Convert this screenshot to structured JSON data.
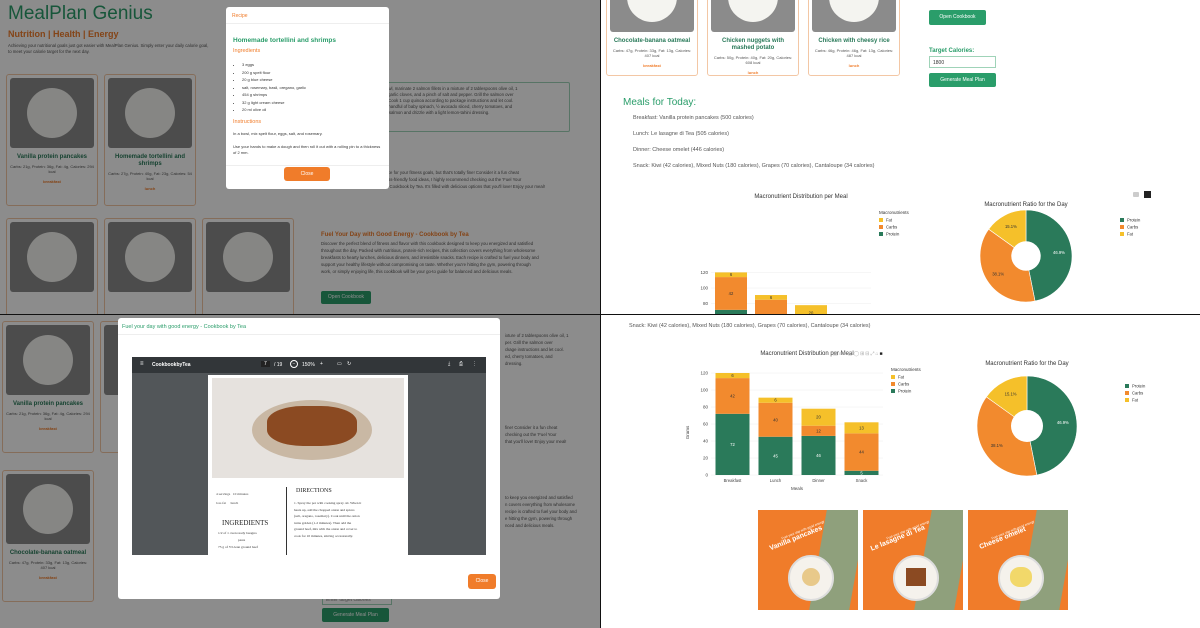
{
  "app": {
    "title": "MealPlan Genius",
    "tagline": "Nutrition | Health | Energy",
    "intro": "Achieving your nutritional goals just got easier with MealPlan Genius. Simply enter your daily calorie goal,",
    "intro2": "to meet your calorie target for the next day."
  },
  "meals": [
    {
      "name": "Vanilla protein pancakes",
      "macros": "Carbs: 21g, Protein: 36g, Fat: 4g, Calories: 294 kcal",
      "label": "breakfast"
    },
    {
      "name": "Homemade tortellini and shrimps",
      "macros": "Carbs: 27g, Protein: 40g, Fat: 23g, Calories: 54 kcal",
      "label": "lunch"
    },
    {
      "name": "Chocolate-banana oatmeal",
      "macros": "Carbs: 47g, Protein: 33g, Fat: 13g, Calories: 407 kcal",
      "label": "breakfast"
    },
    {
      "name": "Chicken nuggets with mashed potato",
      "macros": "Carbs: 50g, Protein: 40g, Fat: 20g, Calories: 608 kcal",
      "label": "lunch"
    },
    {
      "name": "Chicken with cheesy rice",
      "macros": "Carbs: 46g, Protein: 46g, Fat: 13g, Calories: 487 kcal",
      "label": "lunch"
    }
  ],
  "recipe_modal": {
    "header": "Recipe",
    "title": "Homemade tortellini and shrimps",
    "ingredients_title": "Ingredients",
    "ingredients": [
      "3 eggs",
      "200 g spelt flour",
      "20 g blue cheese",
      "salt, rosemary, basil, oregano, garlic",
      "454 g shrimps",
      "32 g light cream cheese",
      "20 ml olive oil"
    ],
    "instructions_title": "Instructions",
    "instructions": [
      "In a bowl, mix spelt flour, eggs, salt, and rosemary.",
      "Use your hands to make a dough and then roll it out with a rolling pin to a thickness of 2 mm."
    ],
    "close": "Close"
  },
  "q1_side": {
    "line1": "e bowl, marinate 2 salmon fillets in a mixture of 2 tablespoons olive oil, 1",
    "line2": "ced garlic cloves, and a pinch of salt and pepper. Grill the salmon over",
    "line3": "ide. Cook 1 cup quinoa according to package instructions and let cool.",
    "line4": "e, a handful of baby spinach, ½ avocado sliced, cherry tomatoes, and",
    "line5": "illed salmon and drizzle with a light lemon-tahini dressing.",
    "choice1": "choice for your fitness goals, but that's totally fine! Consider it a fun cheat",
    "choice2": "fitness-friendly food ideas, I highly recommend checking out the 'Fuel Your",
    "choice3": "ergy Cookbook by Tea. It's filled with delicious options that you'll love! Enjoy your meal!"
  },
  "cookbook": {
    "title": "Fuel Your Day with Good Energy - Cookbook by Tea",
    "desc": [
      "Discover the perfect blend of fitness and flavor with this cookbook designed to keep you energized and satisfied",
      "throughout the day. Packed with nutritious, protein-rich recipes, this collection covers everything from wholesome",
      "breakfasts to hearty lunches, delicious dinners, and irresistible snacks. Each recipe is crafted to fuel your body and",
      "support your healthy lifestyle without compromising on taste. Whether you're hitting the gym, powering through",
      "work, or simply enjoying life, this cookbook will be your go-to guide for balanced and delicious meals."
    ],
    "button": "Open Cookbook"
  },
  "target": {
    "label": "Target Calories:",
    "value": "1800",
    "placeholder": "Enter target calories",
    "button": "Generate Meal Plan"
  },
  "today": {
    "heading": "Meals for Today:",
    "breakfast": "Breakfast: Vanilla protein pancakes (500 calories)",
    "lunch": "Lunch: Le lasagne di Tea (505 calories)",
    "dinner": "Dinner: Cheese omelet (446 calories)",
    "snack": "Snack: Kiwi (42 calories), Mixed Nuts (180 calories), Grapes (70 calories), Cantaloupe (34 calories)"
  },
  "pdf_modal": {
    "header": "Fuel your day with good energy - Cookbook by Tea",
    "doc_name": "CookbookbyTea",
    "page": "7",
    "of": "/ 19",
    "zoom": "150%",
    "directions": "DIRECTIONS",
    "ingredients": "INGREDIENTS",
    "ing1": "1/2 of 1 oven ready lasagna",
    "ing2": "pasta",
    "ing3": "75 g of 5% lean ground beef",
    "meta1": "4 servings",
    "meta2": "10 minutes",
    "meta3": "low-fat",
    "meta4": "lunch",
    "step1": "1. Spray the pot with cooking spray oil. When it",
    "step2": "heats up, add the chopped onion and spices",
    "step3": "(salt, oregano, rosemary). Cook until the onion",
    "step4": "turns golden (1-2 minutes). Then add the",
    "step5": "ground beef, mix with the onion and cover to",
    "step6": "cook for 10 minutes, stirring occasionally.",
    "close": "Close"
  },
  "q3_side": {
    "a": "ixture of 2 tablespoons olive oil, 1",
    "b": "per. Grill the salmon over",
    "c": "ckage instructions and let cool.",
    "d": "ed, cherry tomatoes, and",
    "e": "dressing.",
    "f": "fine! Consider it a fun cheat",
    "g": "checking out the 'Fuel Your",
    "h": "that you'll love! Enjoy your meal!",
    "i": "to keep you energized and satisfied",
    "j": "n covers everything from wholesome",
    "k": "recipe is crafted to fuel your body and",
    "l": "e hitting the gym, powering through",
    "m": "nced and delicious meals."
  },
  "posters": [
    {
      "title": "Vanilla pancakes"
    },
    {
      "title": "Le lasagne di Tea"
    },
    {
      "title": "Cheese omelet"
    }
  ],
  "poster_tag": "Fuel your day with good energy",
  "colors": {
    "green": "#2a9d6a",
    "orange": "#f07c2a",
    "protein": "#2a7a5a",
    "carbs": "#f28a2e",
    "fat": "#f5c02a"
  },
  "chart_data": [
    {
      "type": "bar",
      "title": "Macronutrient Distribution per Meal",
      "xlabel": "Meals",
      "ylabel": "Grams",
      "ylim": [
        0,
        130
      ],
      "categories": [
        "Breakfast",
        "Lunch",
        "Dinner",
        "Snack"
      ],
      "legend_title": "Macronutrients",
      "series": [
        {
          "name": "Protein",
          "values": [
            72,
            45,
            46,
            5
          ]
        },
        {
          "name": "Carbs",
          "values": [
            42,
            40,
            12,
            44
          ]
        },
        {
          "name": "Fat",
          "values": [
            6,
            6,
            20,
            13
          ]
        }
      ],
      "stacked": true,
      "legend": "top-right"
    },
    {
      "type": "pie",
      "title": "Macronutrient Ratio for the Day",
      "hole": true,
      "labels": [
        "Protein",
        "Carbs",
        "Fat"
      ],
      "values": [
        46.9,
        38.1,
        15.1
      ],
      "value_labels": [
        "46.9%",
        "38.1%",
        "15.1%"
      ],
      "legend": "right"
    }
  ]
}
